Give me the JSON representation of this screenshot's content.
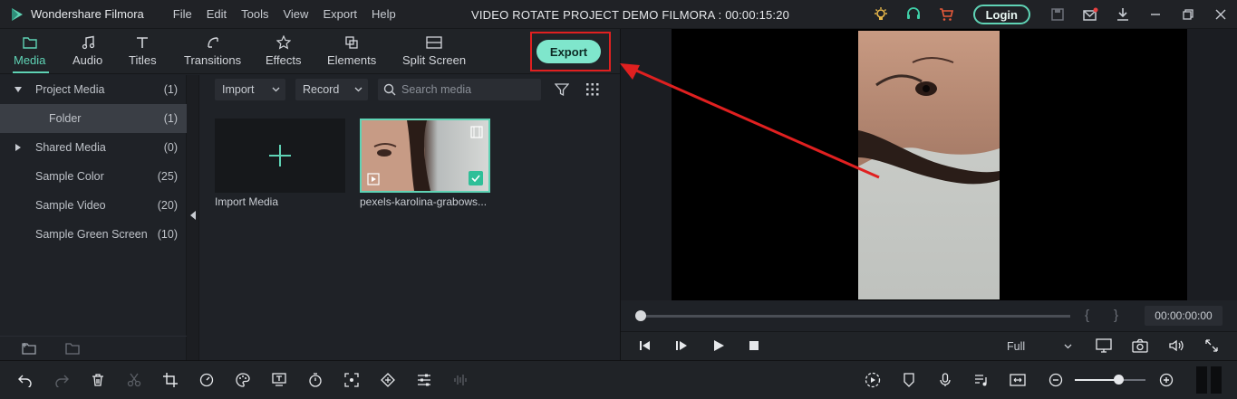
{
  "app": {
    "name": "Wondershare Filmora",
    "project_title": "VIDEO ROTATE PROJECT DEMO FILMORA : 00:00:15:20",
    "login_label": "Login"
  },
  "menu": [
    "File",
    "Edit",
    "Tools",
    "View",
    "Export",
    "Help"
  ],
  "tabs": [
    {
      "label": "Media",
      "icon": "folder-icon",
      "active": true
    },
    {
      "label": "Audio",
      "icon": "music-note-icon"
    },
    {
      "label": "Titles",
      "icon": "text-t-icon"
    },
    {
      "label": "Transitions",
      "icon": "transitions-icon"
    },
    {
      "label": "Effects",
      "icon": "effects-icon"
    },
    {
      "label": "Elements",
      "icon": "elements-icon"
    },
    {
      "label": "Split Screen",
      "icon": "split-screen-icon"
    }
  ],
  "export_label": "Export",
  "sidebar": {
    "items": [
      {
        "label": "Project Media",
        "count": "(1)",
        "expanded": true
      },
      {
        "label": "Folder",
        "count": "(1)",
        "selected": true
      },
      {
        "label": "Shared Media",
        "count": "(0)"
      },
      {
        "label": "Sample Color",
        "count": "(25)"
      },
      {
        "label": "Sample Video",
        "count": "(20)"
      },
      {
        "label": "Sample Green Screen",
        "count": "(10)"
      }
    ]
  },
  "media_toolbar": {
    "import_label": "Import",
    "record_label": "Record",
    "search_placeholder": "Search media"
  },
  "media_items": [
    {
      "label": "Import Media"
    },
    {
      "label": "pexels-karolina-grabows..."
    }
  ],
  "preview": {
    "timecode": "00:00:00:00",
    "bracket_in": "{",
    "bracket_out": "}",
    "quality": "Full"
  },
  "colors": {
    "accent": "#5fd3b5",
    "export_button": "#7fe6cc",
    "highlight_box": "#e02020"
  }
}
